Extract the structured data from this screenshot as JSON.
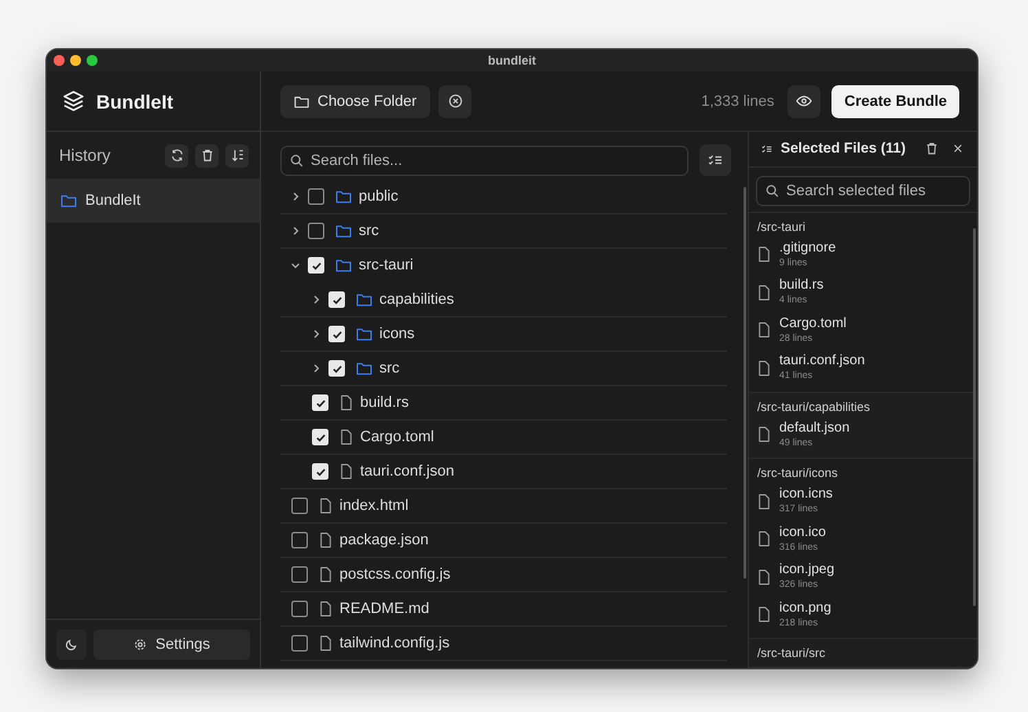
{
  "window": {
    "title": "bundleit"
  },
  "sidebar": {
    "app_name": "BundleIt",
    "history_label": "History",
    "history_items": [
      {
        "label": "BundleIt",
        "selected": true
      }
    ],
    "settings_label": "Settings"
  },
  "toolbar": {
    "choose_folder_label": "Choose Folder",
    "line_count": "1,333 lines",
    "create_bundle_label": "Create Bundle"
  },
  "file_tree": {
    "search_placeholder": "Search files...",
    "items": [
      {
        "name": "public",
        "kind": "folder",
        "checked": false,
        "expanded": false
      },
      {
        "name": "src",
        "kind": "folder",
        "checked": false,
        "expanded": false
      },
      {
        "name": "src-tauri",
        "kind": "folder",
        "checked": true,
        "expanded": true,
        "children": [
          {
            "name": "capabilities",
            "kind": "folder",
            "checked": true,
            "expanded": false
          },
          {
            "name": "icons",
            "kind": "folder",
            "checked": true,
            "expanded": false
          },
          {
            "name": "src",
            "kind": "folder",
            "checked": true,
            "expanded": false
          },
          {
            "name": "build.rs",
            "kind": "file",
            "checked": true
          },
          {
            "name": "Cargo.toml",
            "kind": "file",
            "checked": true
          },
          {
            "name": "tauri.conf.json",
            "kind": "file",
            "checked": true
          }
        ]
      },
      {
        "name": "index.html",
        "kind": "file",
        "checked": false
      },
      {
        "name": "package.json",
        "kind": "file",
        "checked": false
      },
      {
        "name": "postcss.config.js",
        "kind": "file",
        "checked": false
      },
      {
        "name": "README.md",
        "kind": "file",
        "checked": false
      },
      {
        "name": "tailwind.config.js",
        "kind": "file",
        "checked": false
      }
    ]
  },
  "selected_panel": {
    "title": "Selected Files (11)",
    "search_placeholder": "Search selected files",
    "groups": [
      {
        "path": "/src-tauri",
        "files": [
          {
            "name": ".gitignore",
            "lines": "9 lines"
          },
          {
            "name": "build.rs",
            "lines": "4 lines"
          },
          {
            "name": "Cargo.toml",
            "lines": "28 lines"
          },
          {
            "name": "tauri.conf.json",
            "lines": "41 lines"
          }
        ]
      },
      {
        "path": "/src-tauri/capabilities",
        "files": [
          {
            "name": "default.json",
            "lines": "49 lines"
          }
        ]
      },
      {
        "path": "/src-tauri/icons",
        "files": [
          {
            "name": "icon.icns",
            "lines": "317 lines"
          },
          {
            "name": "icon.ico",
            "lines": "316 lines"
          },
          {
            "name": "icon.jpeg",
            "lines": "326 lines"
          },
          {
            "name": "icon.png",
            "lines": "218 lines"
          }
        ]
      },
      {
        "path": "/src-tauri/src"
      }
    ]
  }
}
